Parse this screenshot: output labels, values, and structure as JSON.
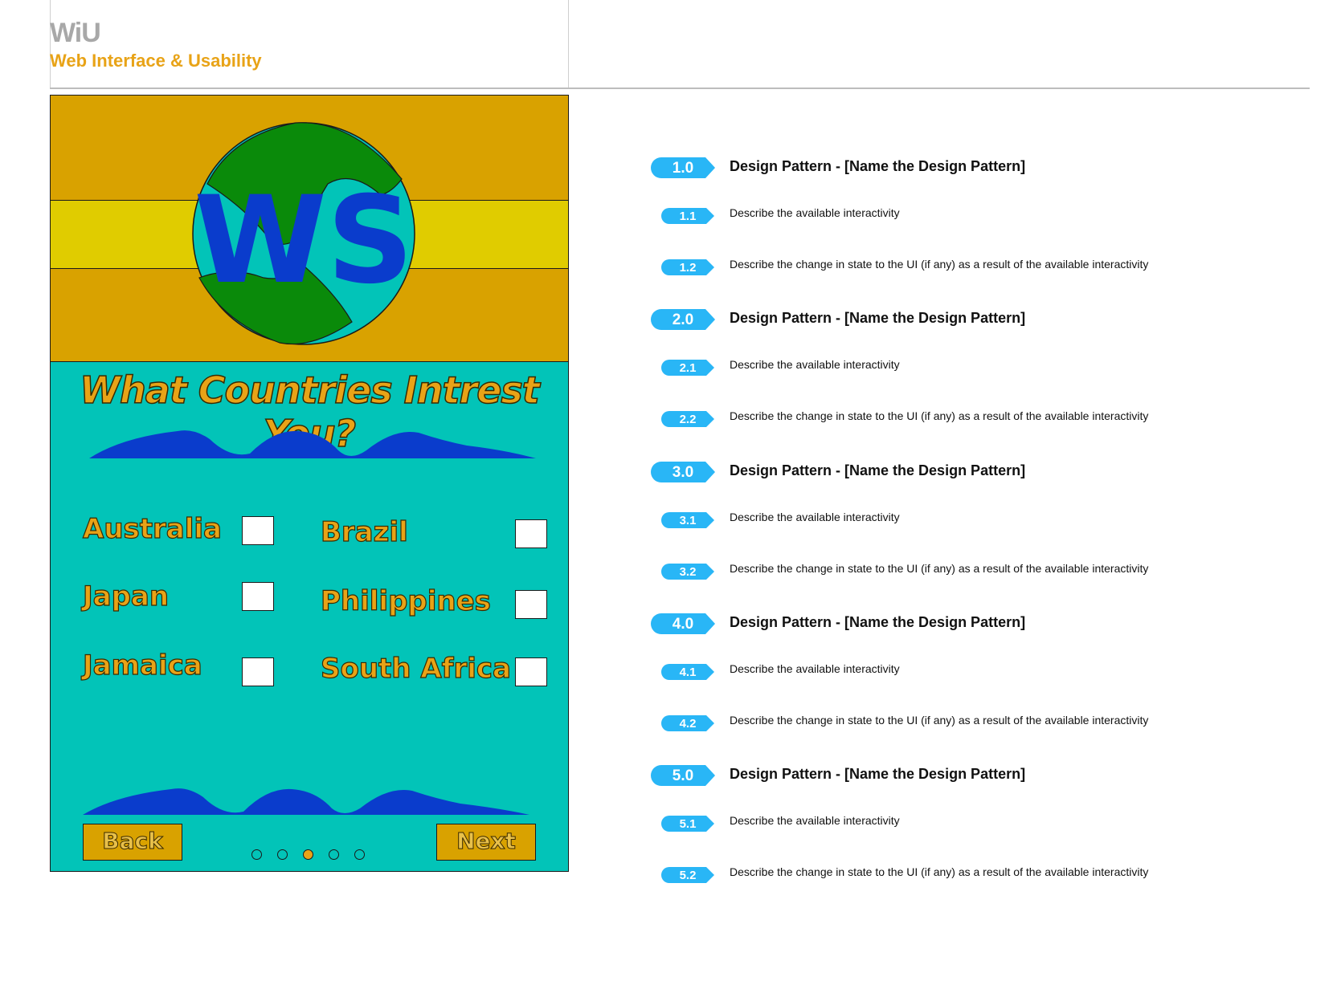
{
  "brand": {
    "logo": "WiU",
    "subtitle": "Web Interface & Usability"
  },
  "mockup": {
    "logo_text": "WS",
    "question": "What Countries Intrest You?",
    "countries": [
      {
        "label": "Australia",
        "checked": false
      },
      {
        "label": "Brazil",
        "checked": false
      },
      {
        "label": "Japan",
        "checked": false
      },
      {
        "label": "Philippines",
        "checked": false
      },
      {
        "label": "Jamaica",
        "checked": false
      },
      {
        "label": "South Africa",
        "checked": false
      }
    ],
    "back_label": "Back",
    "next_label": "Next",
    "pagination": {
      "total": 5,
      "active": 3
    },
    "colors": {
      "header": "#d9a200",
      "stripe": "#e0cc00",
      "body": "#02c4b8",
      "wave": "#0a3ccc",
      "accent": "#e8a317",
      "globe_land": "#0a8a0a"
    }
  },
  "annotations": [
    {
      "badge": "1.0",
      "title": "Design Pattern - [Name the Design Pattern]",
      "items": [
        {
          "badge": "1.1",
          "text": "Describe the available interactivity"
        },
        {
          "badge": "1.2",
          "text": "Describe the change in state to the UI (if any) as a result of the available interactivity"
        }
      ]
    },
    {
      "badge": "2.0",
      "title": "Design Pattern - [Name the Design Pattern]",
      "items": [
        {
          "badge": "2.1",
          "text": "Describe the available interactivity"
        },
        {
          "badge": "2.2",
          "text": "Describe the change in state to the UI (if any) as a result of the available interactivity"
        }
      ]
    },
    {
      "badge": "3.0",
      "title": "Design Pattern - [Name the Design Pattern]",
      "items": [
        {
          "badge": "3.1",
          "text": "Describe the available interactivity"
        },
        {
          "badge": "3.2",
          "text": "Describe the change in state to the UI (if any) as a result of the available interactivity"
        }
      ]
    },
    {
      "badge": "4.0",
      "title": "Design Pattern - [Name the Design Pattern]",
      "items": [
        {
          "badge": "4.1",
          "text": "Describe the available interactivity"
        },
        {
          "badge": "4.2",
          "text": "Describe the change in state to the UI (if any) as a result of the available interactivity"
        }
      ]
    },
    {
      "badge": "5.0",
      "title": "Design Pattern - [Name the Design Pattern]",
      "items": [
        {
          "badge": "5.1",
          "text": "Describe the available interactivity"
        },
        {
          "badge": "5.2",
          "text": "Describe the change in state to the UI (if any) as a result of the available interactivity"
        }
      ]
    }
  ],
  "badge_color": "#29b6f6"
}
